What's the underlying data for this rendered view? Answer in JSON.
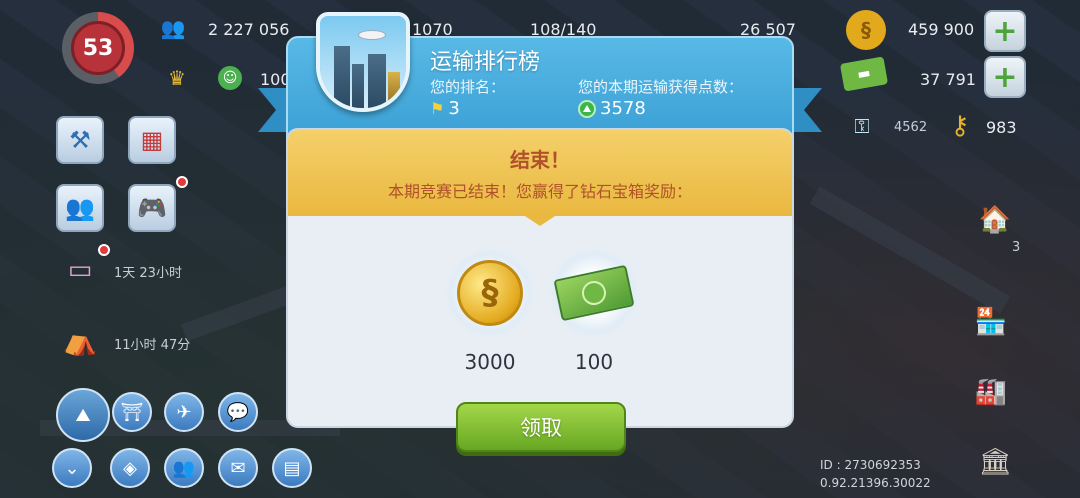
{
  "hud": {
    "level": "53",
    "population": "2 227 056",
    "stat_b": "1070",
    "stat_c": "108/140",
    "stat_d": "26 507",
    "stat_e": "100",
    "simoleons": "459 900",
    "simcash": "37 791",
    "keys_small": "4562",
    "keys": "983",
    "timer_chest": "1天 23小时",
    "timer_tent": "11小时 47分",
    "badge_count": "3"
  },
  "dialog": {
    "title": "运输排行榜",
    "rank_label": "您的排名：",
    "rank_value": "3",
    "points_label": "您的本期运输获得点数：",
    "points_value": "3578",
    "end_title": "结束！",
    "end_message": "本期竞赛已结束！您赢得了钻石宝箱奖励：",
    "rewards": [
      {
        "icon": "coin-icon",
        "amount": "3000"
      },
      {
        "icon": "cash-icon",
        "amount": "100"
      }
    ],
    "collect_label": "领取"
  },
  "footer": {
    "id_line": "ID : 2730692353",
    "version": "0.92.21396.30022"
  },
  "colors": {
    "header_blue": "#3a9fd4",
    "band_yellow": "#e9b83f",
    "collect_green": "#67a722",
    "title_text": "#b0512a"
  }
}
